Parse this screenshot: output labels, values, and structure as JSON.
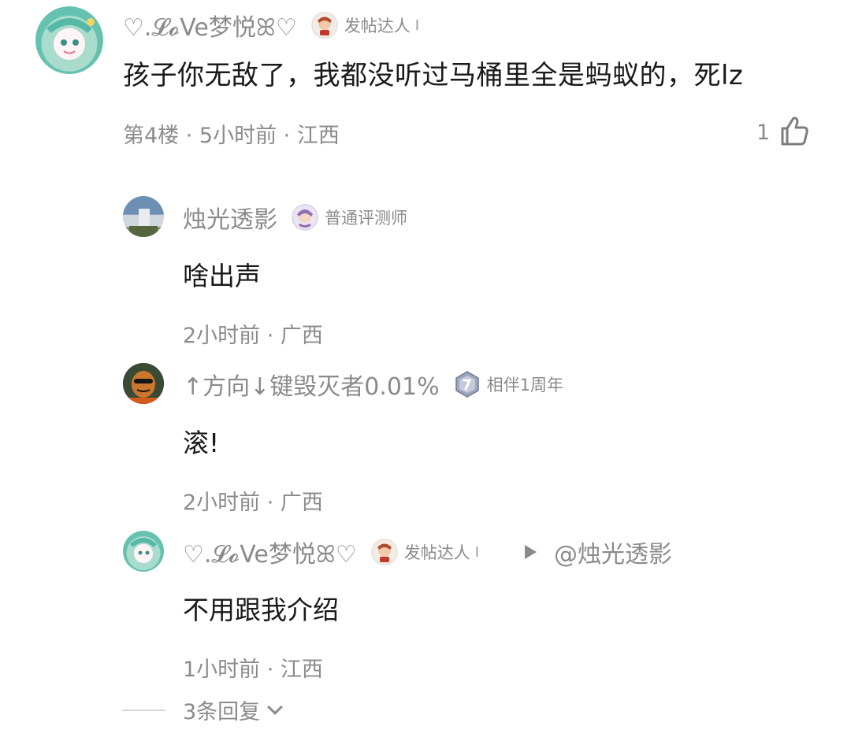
{
  "comment": {
    "username": "♡.𝓛𝓸Ve梦悦ꕤ♡",
    "badge": "发帖达人",
    "badge_sep": "I",
    "text": "孩子你无敌了，我都没听过马桶里全是蚂蚁的，死lz",
    "meta": "第4楼 · 5小时前 · 江西",
    "like_count": "1",
    "replies": [
      {
        "username": "烛光透影",
        "badge": "普通评测师",
        "text": "啥出声",
        "meta": "2小时前 · 广西"
      },
      {
        "username": "↑方向↓键毁灭者0.01%",
        "badge": "相伴1周年",
        "text": "滚!",
        "meta": "2小时前 · 广西"
      },
      {
        "username": "♡.𝓛𝓸Ve梦悦ꕤ♡",
        "badge": "发帖达人",
        "badge_sep": "I",
        "reply_to": "@烛光透影",
        "text": "不用跟我介绍",
        "meta": "1小时前 · 江西"
      }
    ],
    "expand_label": "3条回复"
  }
}
